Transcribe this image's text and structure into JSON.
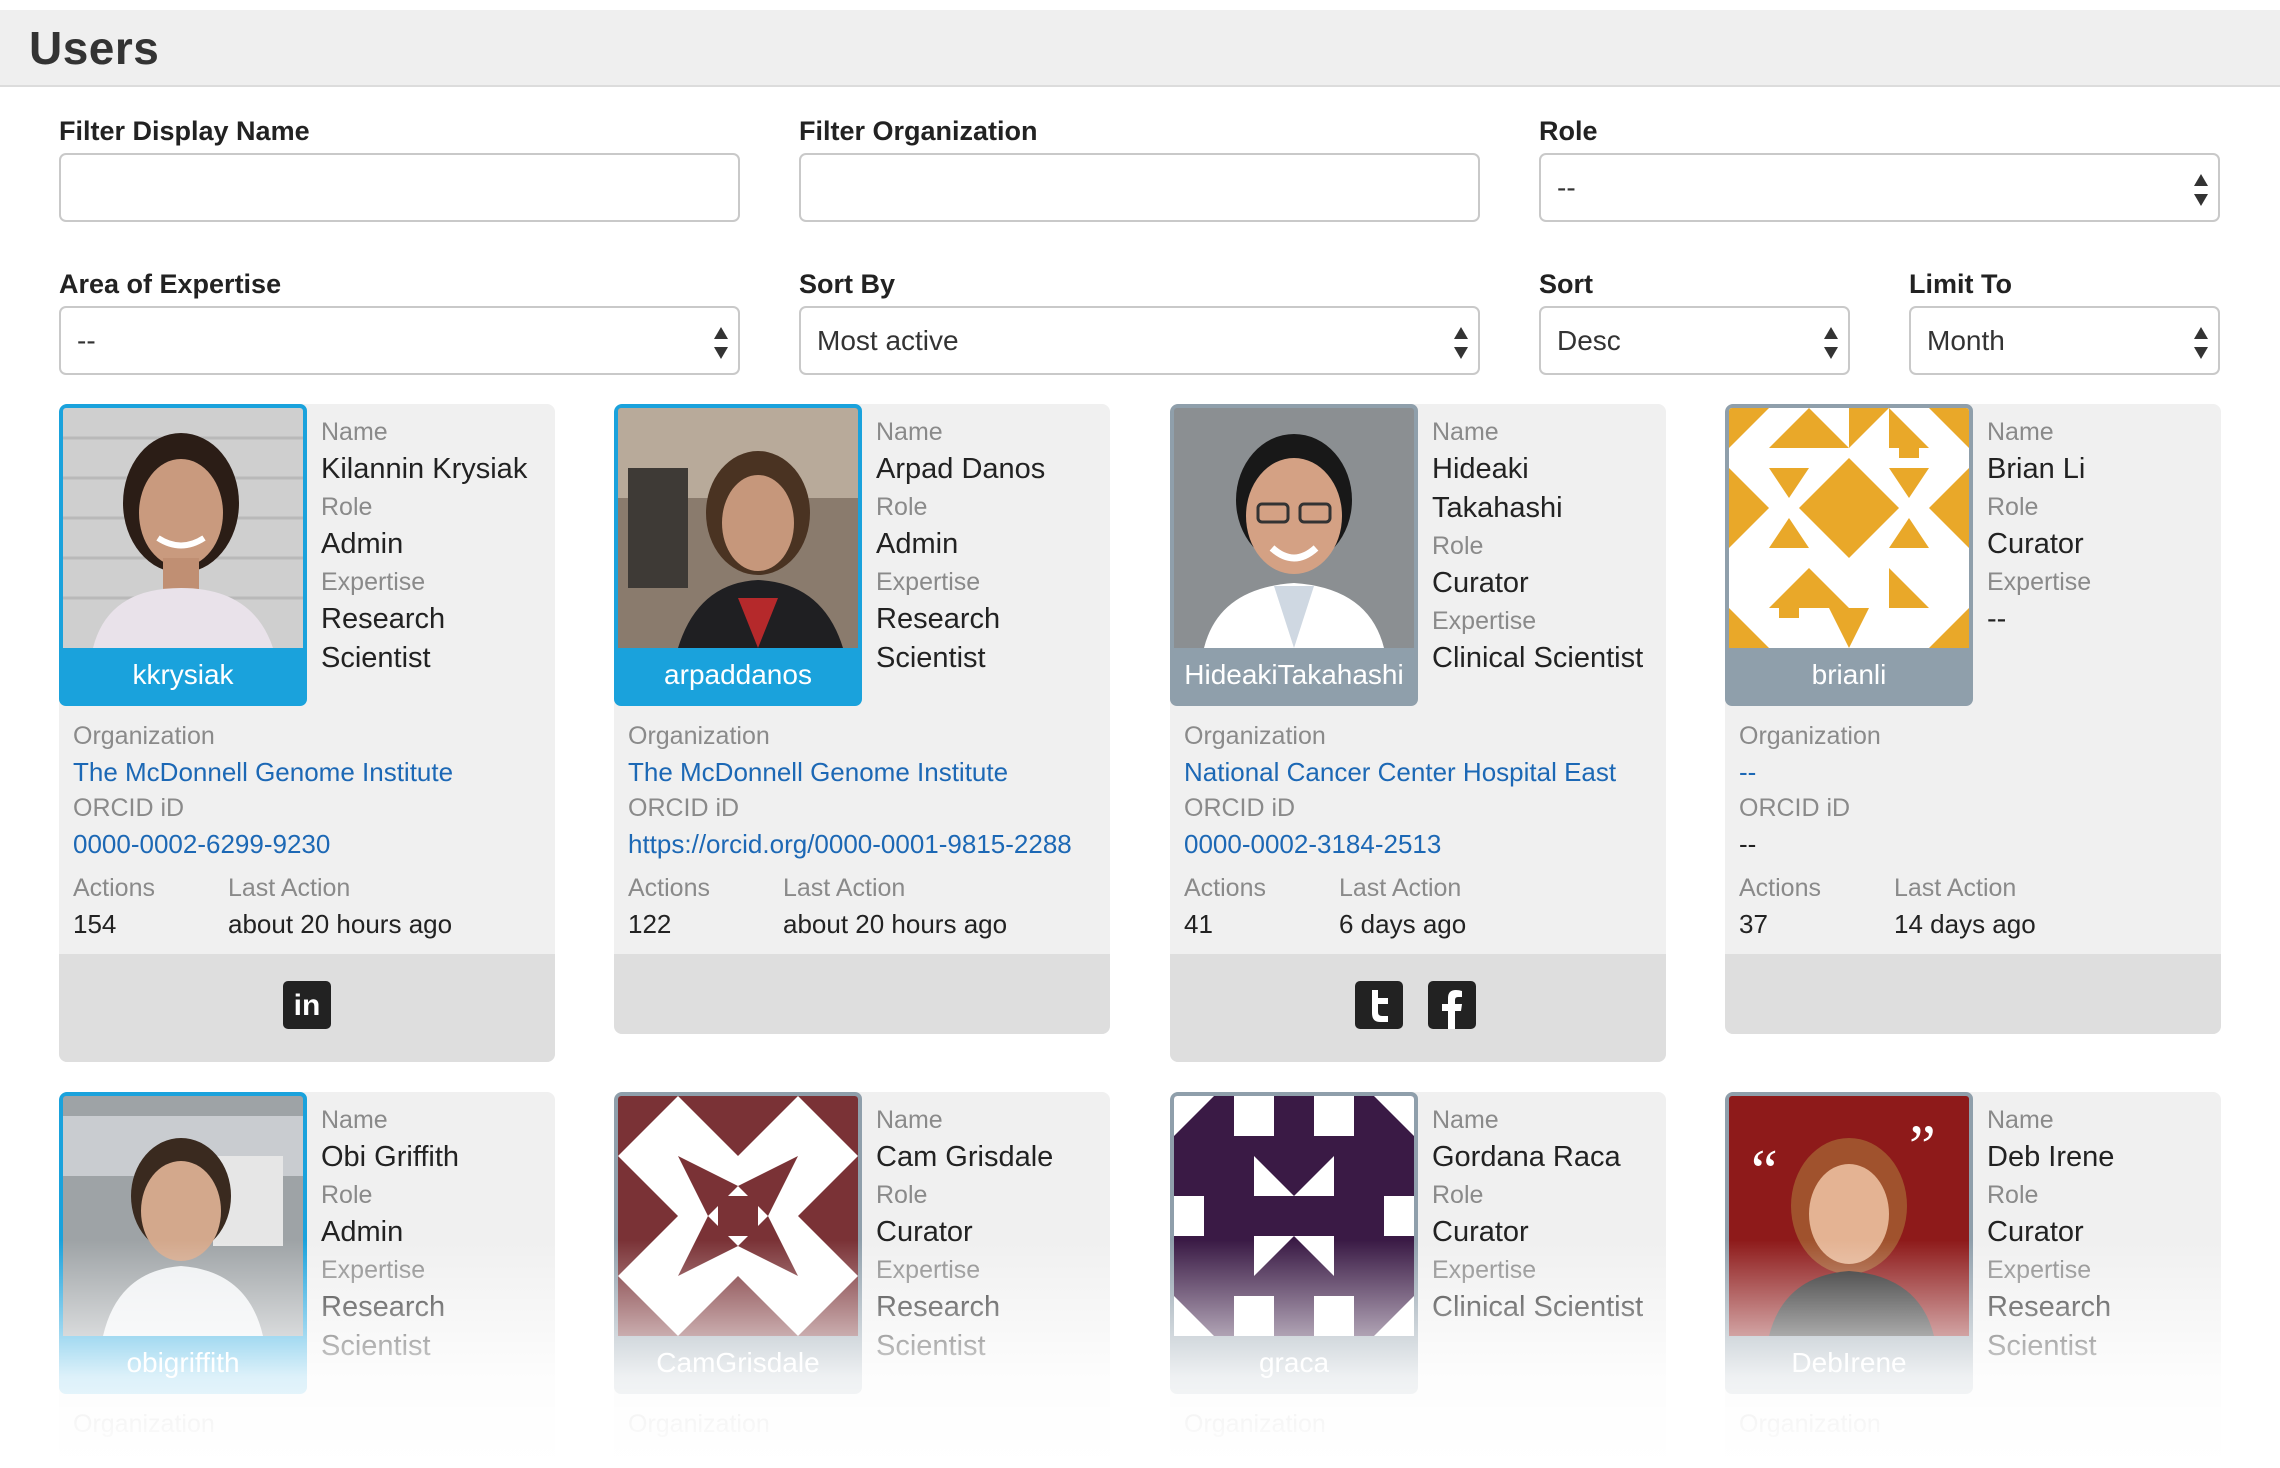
{
  "page": {
    "title": "Users"
  },
  "filters": {
    "display_name": {
      "label": "Filter Display Name",
      "value": ""
    },
    "organization": {
      "label": "Filter Organization",
      "value": ""
    },
    "role": {
      "label": "Role",
      "value": "--"
    },
    "expertise": {
      "label": "Area of Expertise",
      "value": "--"
    },
    "sort_by": {
      "label": "Sort By",
      "value": "Most active"
    },
    "sort": {
      "label": "Sort",
      "value": "Desc"
    },
    "limit_to": {
      "label": "Limit To",
      "value": "Month"
    }
  },
  "labels": {
    "name": "Name",
    "role": "Role",
    "expertise": "Expertise",
    "organization": "Organization",
    "orcid": "ORCID iD",
    "actions": "Actions",
    "last_action": "Last Action"
  },
  "users": [
    {
      "username": "kkrysiak",
      "name_lines": [
        "Kilannin Krysiak"
      ],
      "role": "Admin",
      "expertise_lines": [
        "Research",
        "Scientist"
      ],
      "organization": "The McDonnell Genome Institute",
      "orcid": "0000-0002-6299-9230",
      "actions": "154",
      "last_action": "about 20 hours ago",
      "social": [
        "linkedin-icon"
      ],
      "avatar_color": "#1aa2dc",
      "photo": "photo"
    },
    {
      "username": "arpaddanos",
      "name_lines": [
        "Arpad Danos"
      ],
      "role": "Admin",
      "expertise_lines": [
        "Research",
        "Scientist"
      ],
      "organization": "The McDonnell Genome Institute",
      "orcid": "https://orcid.org/0000-0001-9815-2288",
      "actions": "122",
      "last_action": "about 20 hours ago",
      "social": [],
      "avatar_color": "#1aa2dc",
      "photo": "photo"
    },
    {
      "username": "HideakiTakahashi",
      "name_lines": [
        "Hideaki",
        "Takahashi"
      ],
      "role": "Curator",
      "expertise_lines": [
        "Clinical Scientist"
      ],
      "organization": "National Cancer Center Hospital East",
      "orcid": "0000-0002-3184-2513",
      "actions": "41",
      "last_action": "6 days ago",
      "social": [
        "twitter-icon",
        "facebook-icon"
      ],
      "avatar_color": "#8f9fab",
      "photo": "photo"
    },
    {
      "username": "brianli",
      "name_lines": [
        "Brian Li"
      ],
      "role": "Curator",
      "expertise_lines": [
        "--"
      ],
      "organization": "--",
      "orcid": "--",
      "actions": "37",
      "last_action": "14 days ago",
      "social": [],
      "avatar_color": "#8f9fab",
      "photo": "identicon-yellow"
    },
    {
      "username": "obigriffith",
      "name_lines": [
        "Obi Griffith"
      ],
      "role": "Admin",
      "expertise_lines": [
        "Research",
        "Scientist"
      ],
      "organization": "Organization",
      "avatar_color": "#1aa2dc",
      "photo": "photo"
    },
    {
      "username": "CamGrisdale",
      "name_lines": [
        "Cam Grisdale"
      ],
      "role": "Curator",
      "expertise_lines": [
        "Research",
        "Scientist"
      ],
      "organization": "Organization",
      "avatar_color": "#8f9fab",
      "photo": "identicon-maroon"
    },
    {
      "username": "graca",
      "name_lines": [
        "Gordana Raca"
      ],
      "role": "Curator",
      "expertise_lines": [
        "Clinical Scientist"
      ],
      "organization": "Organization",
      "avatar_color": "#8f9fab",
      "photo": "identicon-purple"
    },
    {
      "username": "DebIrene",
      "name_lines": [
        "Deb Irene"
      ],
      "role": "Curator",
      "expertise_lines": [
        "Research",
        "Scientist"
      ],
      "organization": "Organization",
      "avatar_color": "#8f9fab",
      "photo": "photo"
    }
  ],
  "colors": {
    "accent_blue": "#1aa2dc",
    "avatar_gray": "#8f9fab",
    "link": "#1c68b5",
    "identicon_yellow": "#e9a829",
    "identicon_maroon": "#7a3236",
    "identicon_purple": "#3a1a45"
  }
}
